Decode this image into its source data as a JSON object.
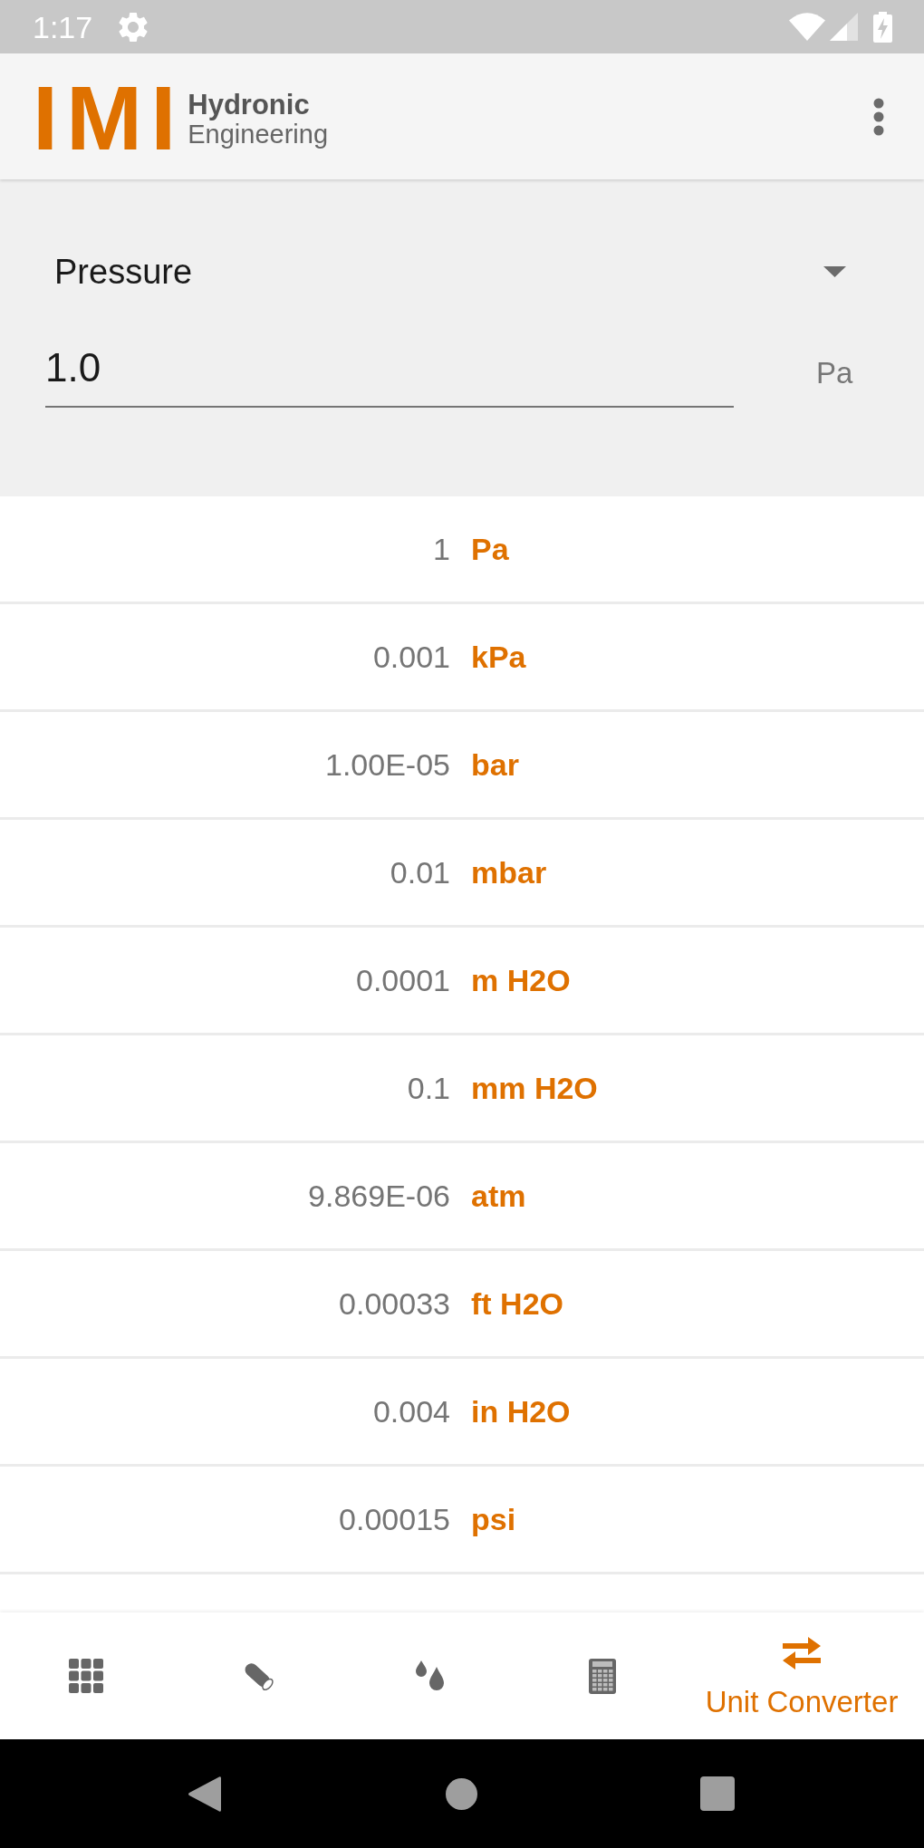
{
  "status_bar": {
    "time": "1:17"
  },
  "app_bar": {
    "logo_text": "IMI",
    "brand_line_1": "Hydronic",
    "brand_line_2": "Engineering"
  },
  "converter": {
    "quantity": {
      "value": "Pressure"
    },
    "input": {
      "value": "1.0",
      "unit": "Pa"
    }
  },
  "results": [
    {
      "value": "1",
      "unit": "Pa"
    },
    {
      "value": "0.001",
      "unit": "kPa"
    },
    {
      "value": "1.00E-05",
      "unit": "bar"
    },
    {
      "value": "0.01",
      "unit": "mbar"
    },
    {
      "value": "0.0001",
      "unit": "m H2O"
    },
    {
      "value": "0.1",
      "unit": "mm H2O"
    },
    {
      "value": "9.869E-06",
      "unit": "atm"
    },
    {
      "value": "0.00033",
      "unit": "ft H2O"
    },
    {
      "value": "0.004",
      "unit": "in H2O"
    },
    {
      "value": "0.00015",
      "unit": "psi"
    }
  ],
  "bottom_nav": [
    {
      "selected": false
    },
    {
      "selected": false
    },
    {
      "selected": false
    },
    {
      "selected": false
    },
    {
      "label": "Unit Converter",
      "selected": true
    }
  ]
}
